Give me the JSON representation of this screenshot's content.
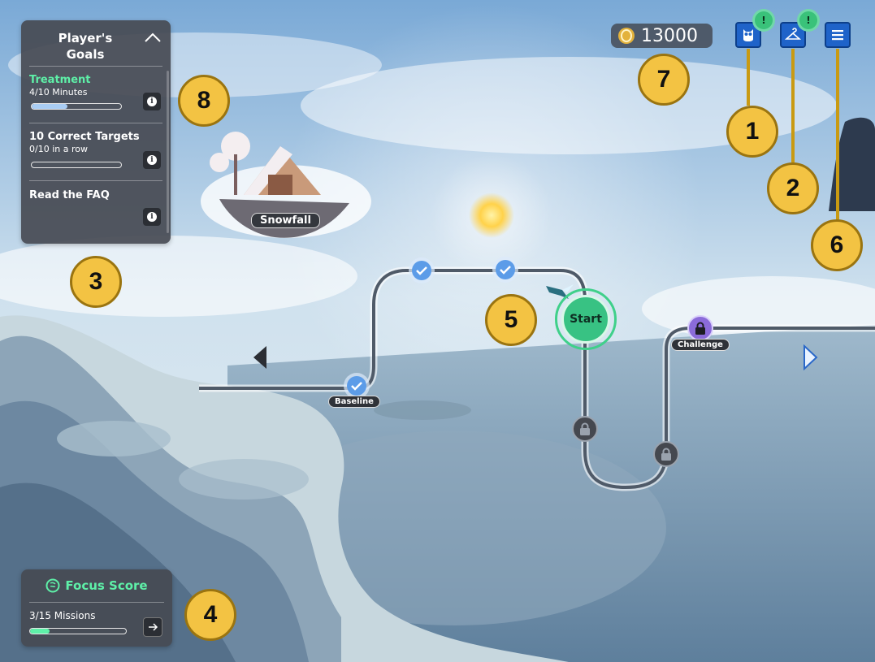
{
  "goals_panel": {
    "title": "Player's\nGoals",
    "items": [
      {
        "title": "Treatment",
        "subtitle": "4/10 Minutes",
        "progress": 0.4,
        "title_color": "#5ef0a8"
      },
      {
        "title": "10 Correct Targets",
        "subtitle": "0/10 in a row",
        "progress": 0.0,
        "title_color": "#ffffff"
      },
      {
        "title": "Read the FAQ",
        "subtitle": "",
        "progress": null,
        "title_color": "#ffffff"
      }
    ]
  },
  "focus_panel": {
    "title": "Focus Score",
    "missions": "3/15 Missions",
    "progress": 0.2,
    "accent": "#5ef0a8"
  },
  "coins": {
    "value": "13000"
  },
  "header_buttons": [
    "owl-icon",
    "hanger-icon",
    "menu-icon"
  ],
  "notification_glyph": "!",
  "map": {
    "island_label": "Snowfall",
    "start_label": "Start",
    "baseline_label": "Baseline",
    "challenge_label": "Challenge",
    "completed_nodes": 3,
    "locked_nodes": 3
  },
  "callouts": [
    "1",
    "2",
    "3",
    "4",
    "5",
    "6",
    "7",
    "8"
  ],
  "colors": {
    "accent_green": "#3ac27a",
    "button_blue": "#1f63c9",
    "callout": "#f3c343",
    "challenge_purple": "#8b6bd9"
  }
}
